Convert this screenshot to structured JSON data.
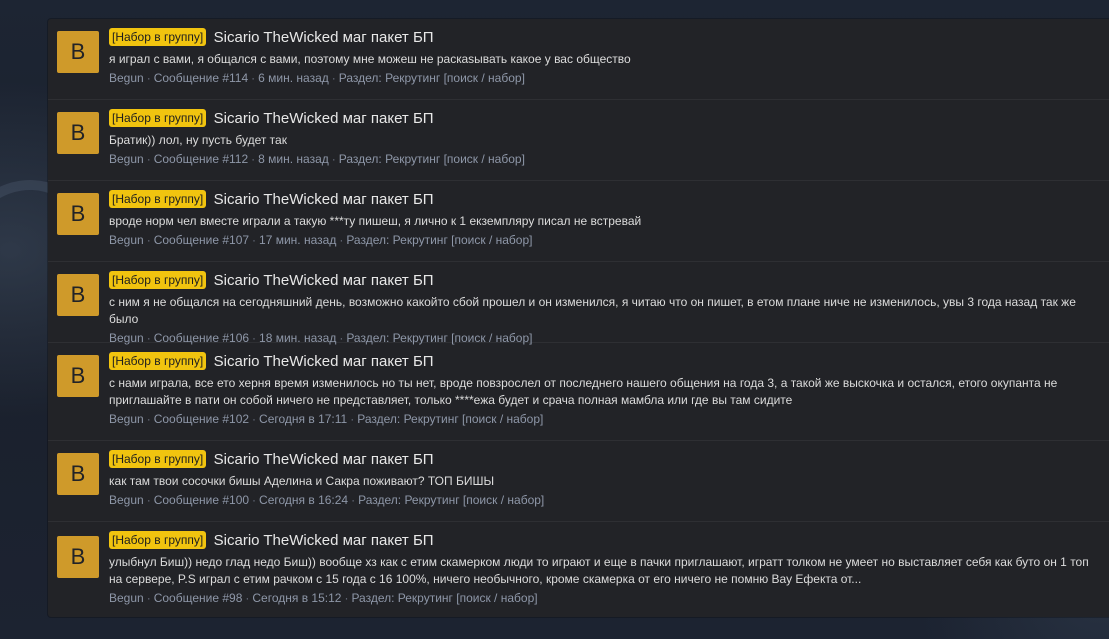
{
  "results": [
    {
      "avatar_letter": "B",
      "prefix": "[Набор в группу]",
      "title": "Sicario TheWicked маг пакет БП",
      "snippet": "я играл с вами, я общался с вами, поэтому мне можеш не раскasывать какое у вас общество",
      "author": "Begun",
      "post": "Сообщение #114",
      "time": "6 мин. назад",
      "section_label": "Раздел:",
      "section": "Рекрутинг [поиск / набор]"
    },
    {
      "avatar_letter": "B",
      "prefix": "[Набор в группу]",
      "title": "Sicario TheWicked маг пакет БП",
      "snippet": "Братик)) лол, ну пусть будет так",
      "author": "Begun",
      "post": "Сообщение #112",
      "time": "8 мин. назад",
      "section_label": "Раздел:",
      "section": "Рекрутинг [поиск / набор]"
    },
    {
      "avatar_letter": "B",
      "prefix": "[Набор в группу]",
      "title": "Sicario TheWicked маг пакет БП",
      "snippet": "вроде норм чел вместе играли а такую ***ту пишеш, я лично к 1 екземпляру писал не встревай",
      "author": "Begun",
      "post": "Сообщение #107",
      "time": "17 мин. назад",
      "section_label": "Раздел:",
      "section": "Рекрутинг [поиск / набор]"
    },
    {
      "avatar_letter": "B",
      "prefix": "[Набор в группу]",
      "title": "Sicario TheWicked маг пакет БП",
      "snippet": "с ним я не общался на сегодняшний день, возможно какойто сбой прошел и он изменился, я читаю что он пишет, в етом плане ниче не изменилось, увы 3 года назад так же было",
      "author": "Begun",
      "post": "Сообщение #106",
      "time": "18 мин. назад",
      "section_label": "Раздел:",
      "section": "Рекрутинг [поиск / набор]"
    },
    {
      "avatar_letter": "B",
      "prefix": "[Набор в группу]",
      "title": "Sicario TheWicked маг пакет БП",
      "snippet": "с нами играла, все ето херня время изменилось но ты нет, вроде повзрослел от последнего нашего общения на года 3, а такой же выскочка и остался, етого окупанта не приглашайте в пати он собой ничего не представляет, только ****ежа будет и срача полная мамбла или где вы там сидите",
      "author": "Begun",
      "post": "Сообщение #102",
      "time": "Сегодня в 17:11",
      "section_label": "Раздел:",
      "section": "Рекрутинг [поиск / набор]"
    },
    {
      "avatar_letter": "B",
      "prefix": "[Набор в группу]",
      "title": "Sicario TheWicked маг пакет БП",
      "snippet": "как там твои сосочки бишы Аделина и Сакра поживают? ТОП БИШЫ",
      "author": "Begun",
      "post": "Сообщение #100",
      "time": "Сегодня в 16:24",
      "section_label": "Раздел:",
      "section": "Рекрутинг [поиск / набор]"
    },
    {
      "avatar_letter": "B",
      "prefix": "[Набор в группу]",
      "title": "Sicario TheWicked маг пакет БП",
      "snippet": "улыбнул Биш)) недо глад недо Биш)) вообще хз как с етим скамерком люди то играют и еще в пачки приглашают, игратт толком не умеет но выставляет себя как буто он 1 топ на сервере, P.S играл с етим рачком с 15 года с 16 100%, ничего необычного, кроме скамерка от его ничего не помню Вау Ефекта от...",
      "author": "Begun",
      "post": "Сообщение #98",
      "time": "Сегодня в 15:12",
      "section_label": "Раздел:",
      "section": "Рекрутинг [поиск / набор]"
    }
  ]
}
